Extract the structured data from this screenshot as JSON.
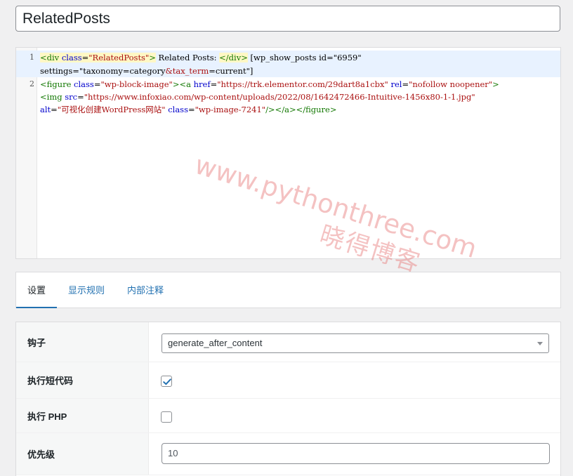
{
  "title_field": {
    "value": "RelatedPosts"
  },
  "code_editor": {
    "lines": [
      {
        "number": "1",
        "segments": [
          {
            "text": "<div",
            "cls": "t-tag tag-hl"
          },
          {
            "text": " ",
            "cls": "tag-hl"
          },
          {
            "text": "class",
            "cls": "t-attr tag-hl"
          },
          {
            "text": "=",
            "cls": "tag-hl"
          },
          {
            "text": "\"RelatedPosts\"",
            "cls": "t-str tag-hl"
          },
          {
            "text": ">",
            "cls": "t-tag tag-hl"
          },
          {
            "text": " Related Posts: ",
            "cls": ""
          },
          {
            "text": "</div>",
            "cls": "t-tag tag-hl"
          },
          {
            "text": " [wp_show_posts id=\"6959\"",
            "cls": ""
          }
        ],
        "segments_wrap": [
          {
            "text": "settings=\"taxonomy=category",
            "cls": ""
          },
          {
            "text": "&tax_term",
            "cls": "t-ent"
          },
          {
            "text": "=current\"]",
            "cls": ""
          }
        ]
      },
      {
        "number": "2",
        "segments": [
          {
            "text": "<figure",
            "cls": "t-tag"
          },
          {
            "text": " ",
            "cls": ""
          },
          {
            "text": "class",
            "cls": "t-attr"
          },
          {
            "text": "=",
            "cls": ""
          },
          {
            "text": "\"wp-block-image\"",
            "cls": "t-str"
          },
          {
            "text": "><a",
            "cls": "t-tag"
          },
          {
            "text": " ",
            "cls": ""
          },
          {
            "text": "href",
            "cls": "t-attr"
          },
          {
            "text": "=",
            "cls": ""
          },
          {
            "text": "\"https://trk.elementor.com/29dart8a1cbx\"",
            "cls": "t-str"
          },
          {
            "text": " ",
            "cls": ""
          },
          {
            "text": "rel",
            "cls": "t-attr"
          },
          {
            "text": "=",
            "cls": ""
          },
          {
            "text": "\"nofollow noopener\"",
            "cls": "t-str"
          },
          {
            "text": ">",
            "cls": "t-tag"
          }
        ],
        "segments_wrap": [
          {
            "text": "<img",
            "cls": "t-tag"
          },
          {
            "text": " ",
            "cls": ""
          },
          {
            "text": "src",
            "cls": "t-attr"
          },
          {
            "text": "=",
            "cls": ""
          },
          {
            "text": "\"https://www.infoxiao.com/wp-content/uploads/2022/08/1642472466-Intuitive-1456x80-1-1.jpg\"",
            "cls": "t-str"
          }
        ],
        "segments_wrap2": [
          {
            "text": "alt",
            "cls": "t-attr"
          },
          {
            "text": "=",
            "cls": ""
          },
          {
            "text": "\"可视化创建WordPress网站\"",
            "cls": "t-str"
          },
          {
            "text": " ",
            "cls": ""
          },
          {
            "text": "class",
            "cls": "t-attr"
          },
          {
            "text": "=",
            "cls": ""
          },
          {
            "text": "\"wp-image-7241\"",
            "cls": "t-str"
          },
          {
            "text": "/></a></figure>",
            "cls": "t-tag"
          }
        ]
      }
    ]
  },
  "watermark": {
    "line1": "www.pythonthree.com",
    "line2": "晓得博客"
  },
  "tabs": [
    {
      "label": "设置",
      "active": true
    },
    {
      "label": "显示规则",
      "active": false
    },
    {
      "label": "内部注释",
      "active": false
    }
  ],
  "settings": {
    "hook": {
      "label": "钩子",
      "value": "generate_after_content"
    },
    "execute_shortcodes": {
      "label": "执行短代码",
      "checked": true
    },
    "execute_php": {
      "label": "执行 PHP",
      "checked": false
    },
    "priority": {
      "label": "优先级",
      "value": "10"
    }
  },
  "colors": {
    "link": "#2271b1",
    "checkmark": "#2271b1",
    "tag": "#117700",
    "attr": "#0000cc",
    "string": "#aa1111"
  }
}
